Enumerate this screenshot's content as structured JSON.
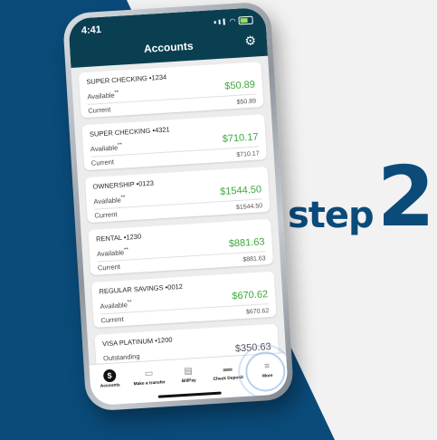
{
  "colors": {
    "navy": "#0a4b7a",
    "header": "#0a3f52",
    "green": "#3ba83b"
  },
  "status": {
    "time": "4:41"
  },
  "header": {
    "title": "Accounts"
  },
  "accounts": [
    {
      "name": "SUPER CHECKING •1234",
      "available_label": "Available",
      "available": "$50.89",
      "current_label": "Current",
      "current": "$50.89"
    },
    {
      "name": "SUPER CHECKING •4321",
      "available_label": "Available",
      "available": "$710.17",
      "current_label": "Current",
      "current": "$710.17"
    },
    {
      "name": "OWNERSHIP •0123",
      "available_label": "Available",
      "available": "$1544.50",
      "current_label": "Current",
      "current": "$1544.50"
    },
    {
      "name": "RENTAL •1230",
      "available_label": "Available",
      "available": "$881.63",
      "current_label": "Current",
      "current": "$881.63"
    },
    {
      "name": "REGULAR SAVINGS •0012",
      "available_label": "Available",
      "available": "$670.62",
      "current_label": "Current",
      "current": "$670.62"
    },
    {
      "name": "VISA PLATINUM •1200",
      "available_label": "Outstanding",
      "available": "$350.63",
      "current_label": "",
      "current": ""
    }
  ],
  "tabs": [
    "Accounts",
    "Make a transfer",
    "BillPay",
    "Check Deposit",
    "More"
  ],
  "promo": {
    "word": "step",
    "number": "2"
  }
}
